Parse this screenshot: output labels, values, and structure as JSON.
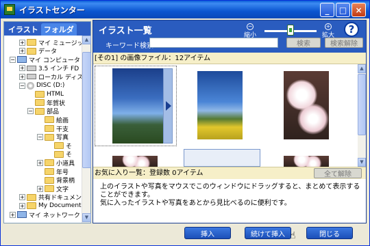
{
  "window": {
    "title": "イラストセンター",
    "controls": {
      "minimize": "_",
      "maximize": "□",
      "close": "×"
    }
  },
  "left_panel": {
    "tabs": [
      "イラスト",
      "フォルダ"
    ],
    "tree": [
      {
        "label": "マイ ミュージック",
        "expander": "+"
      },
      {
        "label": "データ",
        "expander": "+"
      },
      {
        "label": "マイ コンピュータ",
        "expander": "−"
      },
      {
        "label": "3.5 インチ FD",
        "expander": "+"
      },
      {
        "label": "ローカル ディスク",
        "expander": "+"
      },
      {
        "label": "DISC (D:)",
        "expander": "−"
      },
      {
        "label": "HTML",
        "expander": ""
      },
      {
        "label": "年賀状",
        "expander": ""
      },
      {
        "label": "部品",
        "expander": "−"
      },
      {
        "label": "絵画",
        "expander": ""
      },
      {
        "label": "干支",
        "expander": ""
      },
      {
        "label": "写真",
        "expander": "−"
      },
      {
        "label": "そ",
        "expander": ""
      },
      {
        "label": "そ",
        "expander": ""
      },
      {
        "label": "小道具",
        "expander": "+"
      },
      {
        "label": "年号",
        "expander": ""
      },
      {
        "label": "背景柄",
        "expander": ""
      },
      {
        "label": "文字",
        "expander": "+"
      },
      {
        "label": "共有ドキュメント",
        "expander": "+"
      },
      {
        "label": "My Documents",
        "expander": "+"
      },
      {
        "label": "マイ ネットワーク",
        "expander": "+"
      }
    ]
  },
  "right_panel": {
    "title": "イラスト一覧",
    "zoom": {
      "small_label": "縮小",
      "large_label": "拡大",
      "level": 0.45
    },
    "help_label": "?",
    "keyword_label": "キーワード検索：",
    "keyword_value": "",
    "search_button": "検索",
    "clear_search_button": "検索解除",
    "results_header": "[その1] の画像ファイル：12アイテム",
    "favorites_header": "お気に入り一覧：登録数 0アイテム",
    "clear_all_button": "全て解除",
    "favorites_help_line1": "上のイラストや写真をマウスでこのウィンドウにドラッグすると、まとめて表示することができます。",
    "favorites_help_line2": "気に入ったイラストや写真をあとから見比べるのに便利です。"
  },
  "bottom_buttons": {
    "insert": "挿入",
    "insert_continue": "続けて挿入",
    "close": "閉じる"
  },
  "colors": {
    "titlebar": "#0a55d0",
    "panel_blue": "#2a5cbf",
    "header_cream": "#f6efc8"
  }
}
